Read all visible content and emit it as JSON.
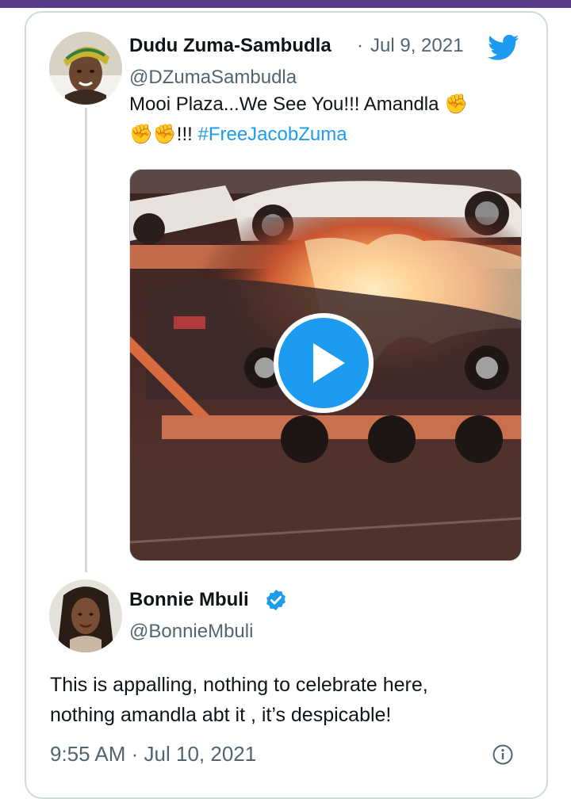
{
  "tweet": {
    "author_name": "Dudu Zuma-Sambudla",
    "separator": "·",
    "date": "Jul 9, 2021",
    "handle": "@DZumaSambudla",
    "text_line1": "Mooi Plaza...We See You!!! Amandla",
    "text_line2_suffix": "!!!",
    "hashtag": "#FreeJacobZuma",
    "emoji_glyph": "✊",
    "emoji_name": "raised-fist-medium-light-skin-tone",
    "brand_icon": "twitter-bird-icon",
    "brand_color": "#1d9bf0"
  },
  "media": {
    "type": "video",
    "control": "play-icon"
  },
  "reply": {
    "author_name": "Bonnie Mbuli",
    "verified_icon": "verified-badge-icon",
    "handle": "@BonnieMbuli",
    "text_line1": "This is appalling, nothing to celebrate here,",
    "text_line2": "nothing amandla abt it , it’s despicable!",
    "time": "9:55 AM",
    "separator": "·",
    "date": "Jul 10, 2021"
  }
}
